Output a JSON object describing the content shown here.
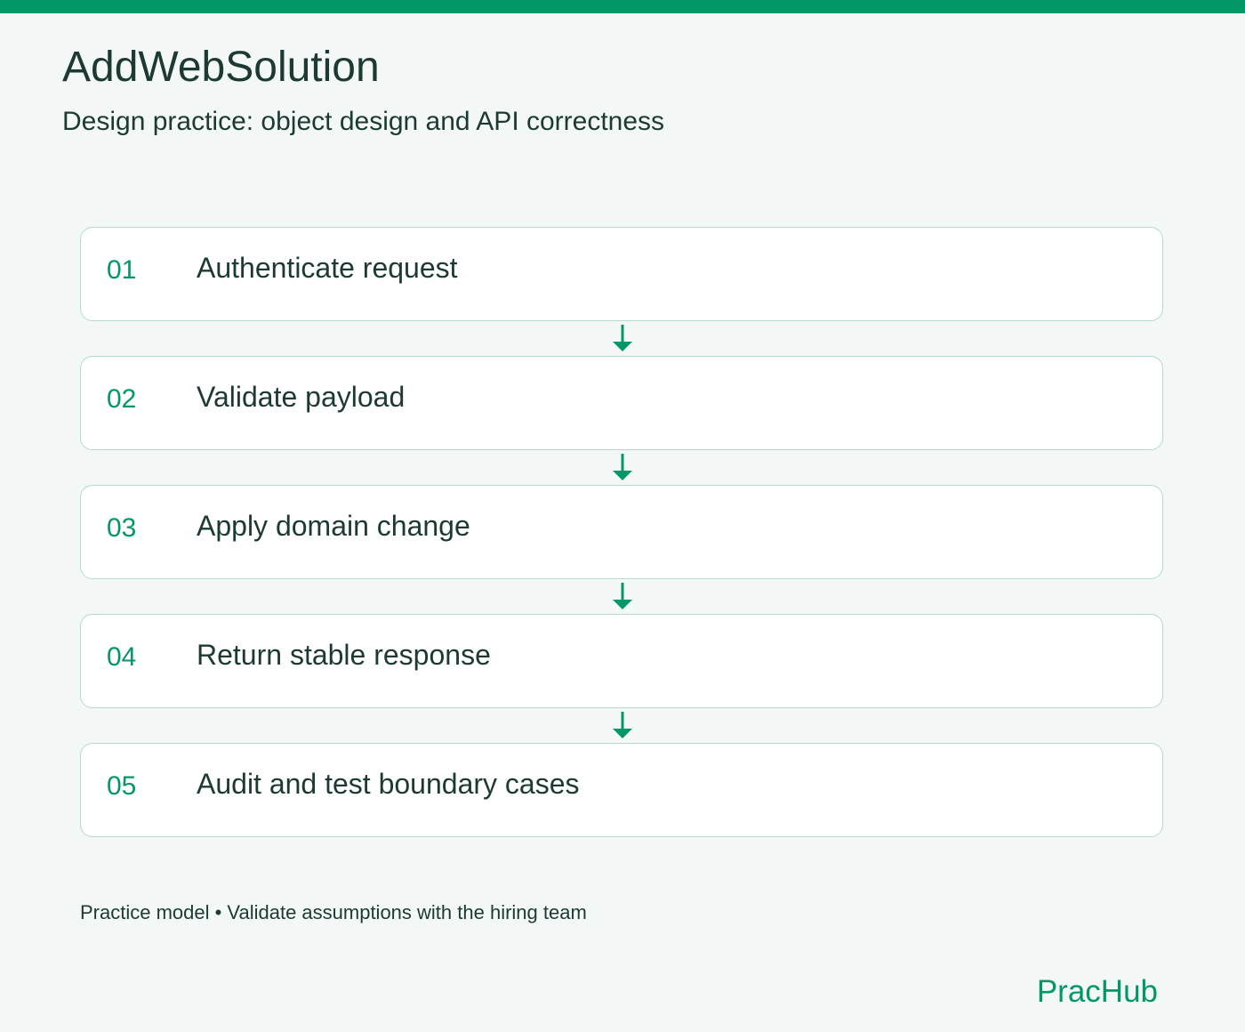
{
  "colors": {
    "accent": "#039669",
    "text": "#1c3a33",
    "background": "#f3f8f6",
    "card": "#ffffff",
    "card_border": "#b3d9cd"
  },
  "header": {
    "title": "AddWebSolution",
    "subtitle": "Design practice: object design and API correctness"
  },
  "steps": [
    {
      "number": "01",
      "label": "Authenticate request"
    },
    {
      "number": "02",
      "label": "Validate payload"
    },
    {
      "number": "03",
      "label": "Apply domain change"
    },
    {
      "number": "04",
      "label": "Return stable response"
    },
    {
      "number": "05",
      "label": "Audit and test boundary cases"
    }
  ],
  "footer": {
    "note": "Practice model • Validate assumptions with the hiring team",
    "brand": "PracHub"
  }
}
